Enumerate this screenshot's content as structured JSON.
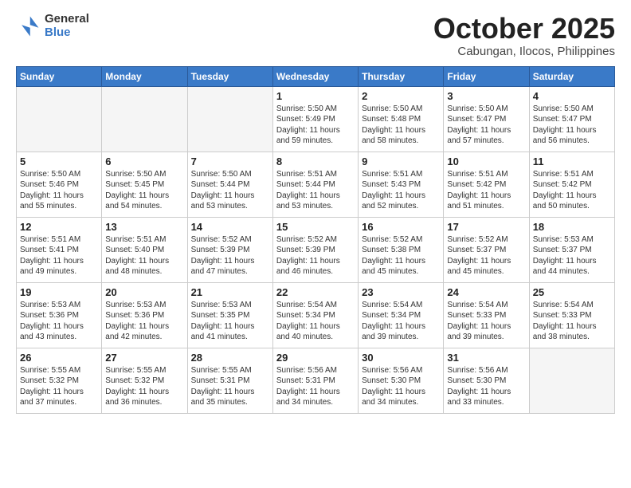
{
  "header": {
    "logo_general": "General",
    "logo_blue": "Blue",
    "month_title": "October 2025",
    "location": "Cabungan, Ilocos, Philippines"
  },
  "weekdays": [
    "Sunday",
    "Monday",
    "Tuesday",
    "Wednesday",
    "Thursday",
    "Friday",
    "Saturday"
  ],
  "weeks": [
    [
      {
        "day": "",
        "info": ""
      },
      {
        "day": "",
        "info": ""
      },
      {
        "day": "",
        "info": ""
      },
      {
        "day": "1",
        "info": "Sunrise: 5:50 AM\nSunset: 5:49 PM\nDaylight: 11 hours\nand 59 minutes."
      },
      {
        "day": "2",
        "info": "Sunrise: 5:50 AM\nSunset: 5:48 PM\nDaylight: 11 hours\nand 58 minutes."
      },
      {
        "day": "3",
        "info": "Sunrise: 5:50 AM\nSunset: 5:47 PM\nDaylight: 11 hours\nand 57 minutes."
      },
      {
        "day": "4",
        "info": "Sunrise: 5:50 AM\nSunset: 5:47 PM\nDaylight: 11 hours\nand 56 minutes."
      }
    ],
    [
      {
        "day": "5",
        "info": "Sunrise: 5:50 AM\nSunset: 5:46 PM\nDaylight: 11 hours\nand 55 minutes."
      },
      {
        "day": "6",
        "info": "Sunrise: 5:50 AM\nSunset: 5:45 PM\nDaylight: 11 hours\nand 54 minutes."
      },
      {
        "day": "7",
        "info": "Sunrise: 5:50 AM\nSunset: 5:44 PM\nDaylight: 11 hours\nand 53 minutes."
      },
      {
        "day": "8",
        "info": "Sunrise: 5:51 AM\nSunset: 5:44 PM\nDaylight: 11 hours\nand 53 minutes."
      },
      {
        "day": "9",
        "info": "Sunrise: 5:51 AM\nSunset: 5:43 PM\nDaylight: 11 hours\nand 52 minutes."
      },
      {
        "day": "10",
        "info": "Sunrise: 5:51 AM\nSunset: 5:42 PM\nDaylight: 11 hours\nand 51 minutes."
      },
      {
        "day": "11",
        "info": "Sunrise: 5:51 AM\nSunset: 5:42 PM\nDaylight: 11 hours\nand 50 minutes."
      }
    ],
    [
      {
        "day": "12",
        "info": "Sunrise: 5:51 AM\nSunset: 5:41 PM\nDaylight: 11 hours\nand 49 minutes."
      },
      {
        "day": "13",
        "info": "Sunrise: 5:51 AM\nSunset: 5:40 PM\nDaylight: 11 hours\nand 48 minutes."
      },
      {
        "day": "14",
        "info": "Sunrise: 5:52 AM\nSunset: 5:39 PM\nDaylight: 11 hours\nand 47 minutes."
      },
      {
        "day": "15",
        "info": "Sunrise: 5:52 AM\nSunset: 5:39 PM\nDaylight: 11 hours\nand 46 minutes."
      },
      {
        "day": "16",
        "info": "Sunrise: 5:52 AM\nSunset: 5:38 PM\nDaylight: 11 hours\nand 45 minutes."
      },
      {
        "day": "17",
        "info": "Sunrise: 5:52 AM\nSunset: 5:37 PM\nDaylight: 11 hours\nand 45 minutes."
      },
      {
        "day": "18",
        "info": "Sunrise: 5:53 AM\nSunset: 5:37 PM\nDaylight: 11 hours\nand 44 minutes."
      }
    ],
    [
      {
        "day": "19",
        "info": "Sunrise: 5:53 AM\nSunset: 5:36 PM\nDaylight: 11 hours\nand 43 minutes."
      },
      {
        "day": "20",
        "info": "Sunrise: 5:53 AM\nSunset: 5:36 PM\nDaylight: 11 hours\nand 42 minutes."
      },
      {
        "day": "21",
        "info": "Sunrise: 5:53 AM\nSunset: 5:35 PM\nDaylight: 11 hours\nand 41 minutes."
      },
      {
        "day": "22",
        "info": "Sunrise: 5:54 AM\nSunset: 5:34 PM\nDaylight: 11 hours\nand 40 minutes."
      },
      {
        "day": "23",
        "info": "Sunrise: 5:54 AM\nSunset: 5:34 PM\nDaylight: 11 hours\nand 39 minutes."
      },
      {
        "day": "24",
        "info": "Sunrise: 5:54 AM\nSunset: 5:33 PM\nDaylight: 11 hours\nand 39 minutes."
      },
      {
        "day": "25",
        "info": "Sunrise: 5:54 AM\nSunset: 5:33 PM\nDaylight: 11 hours\nand 38 minutes."
      }
    ],
    [
      {
        "day": "26",
        "info": "Sunrise: 5:55 AM\nSunset: 5:32 PM\nDaylight: 11 hours\nand 37 minutes."
      },
      {
        "day": "27",
        "info": "Sunrise: 5:55 AM\nSunset: 5:32 PM\nDaylight: 11 hours\nand 36 minutes."
      },
      {
        "day": "28",
        "info": "Sunrise: 5:55 AM\nSunset: 5:31 PM\nDaylight: 11 hours\nand 35 minutes."
      },
      {
        "day": "29",
        "info": "Sunrise: 5:56 AM\nSunset: 5:31 PM\nDaylight: 11 hours\nand 34 minutes."
      },
      {
        "day": "30",
        "info": "Sunrise: 5:56 AM\nSunset: 5:30 PM\nDaylight: 11 hours\nand 34 minutes."
      },
      {
        "day": "31",
        "info": "Sunrise: 5:56 AM\nSunset: 5:30 PM\nDaylight: 11 hours\nand 33 minutes."
      },
      {
        "day": "",
        "info": ""
      }
    ]
  ]
}
